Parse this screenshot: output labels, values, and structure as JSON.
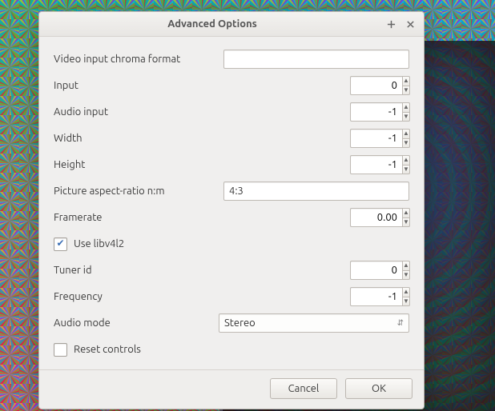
{
  "window": {
    "title": "Advanced Options"
  },
  "fields": {
    "chroma": {
      "label": "Video input chroma format",
      "value": ""
    },
    "input": {
      "label": "Input",
      "value": "0"
    },
    "audio_input": {
      "label": "Audio input",
      "value": "-1"
    },
    "width": {
      "label": "Width",
      "value": "-1"
    },
    "height": {
      "label": "Height",
      "value": "-1"
    },
    "aspect": {
      "label": "Picture aspect-ratio n:m",
      "value": "4:3"
    },
    "framerate": {
      "label": "Framerate",
      "value": "0.00"
    },
    "use_libv4l2": {
      "label": "Use libv4l2",
      "checked": true
    },
    "tuner_id": {
      "label": "Tuner id",
      "value": "0"
    },
    "frequency": {
      "label": "Frequency",
      "value": "-1"
    },
    "audio_mode": {
      "label": "Audio mode",
      "value": "Stereo"
    },
    "reset_controls": {
      "label": "Reset controls",
      "checked": false
    }
  },
  "buttons": {
    "cancel": "Cancel",
    "ok": "OK"
  }
}
